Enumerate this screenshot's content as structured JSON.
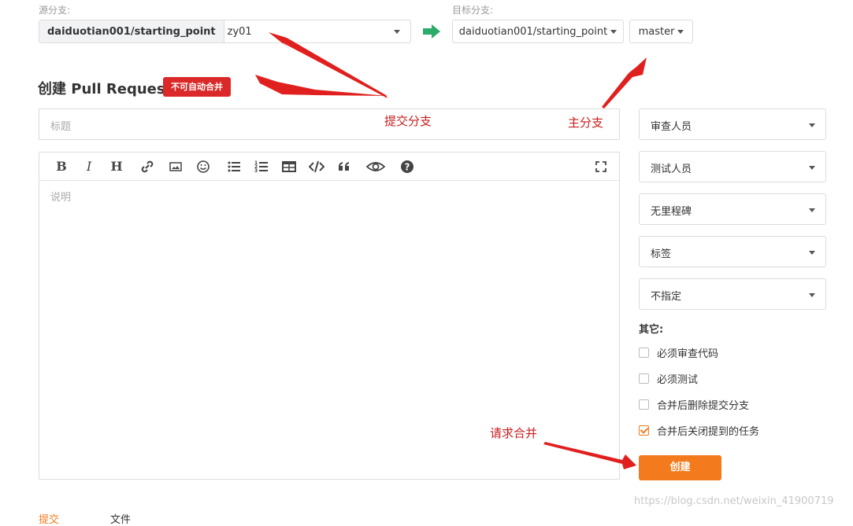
{
  "source": {
    "label": "源分支:",
    "repo": "daiduotian001/starting_point",
    "branch": "zy01"
  },
  "target": {
    "label": "目标分支:",
    "repo": "daiduotian001/starting_point",
    "branch": "master"
  },
  "header": {
    "title": "创建 Pull Request",
    "badge": "不可自动合并"
  },
  "form": {
    "title_placeholder": "标题",
    "desc_placeholder": "说明"
  },
  "sidebar": {
    "selects": [
      "审查人员",
      "测试人员",
      "无里程碑",
      "标签",
      "不指定"
    ],
    "other_label": "其它:",
    "checks": [
      {
        "label": "必须审查代码",
        "checked": false
      },
      {
        "label": "必须测试",
        "checked": false
      },
      {
        "label": "合并后删除提交分支",
        "checked": false
      },
      {
        "label": "合并后关闭提到的任务",
        "checked": true
      }
    ],
    "create_label": "创建"
  },
  "annotations": {
    "commit_branch": "提交分支",
    "main_branch": "主分支",
    "request_merge": "请求合并"
  },
  "watermark": "https://blog.csdn.net/weixin_41900719",
  "bottom_tabs": [
    "提交",
    "文件"
  ],
  "colors": {
    "accent": "#f37b1d",
    "badge": "#db2828",
    "arrow": "#2dab6a",
    "annotation": "#c81e1e"
  }
}
